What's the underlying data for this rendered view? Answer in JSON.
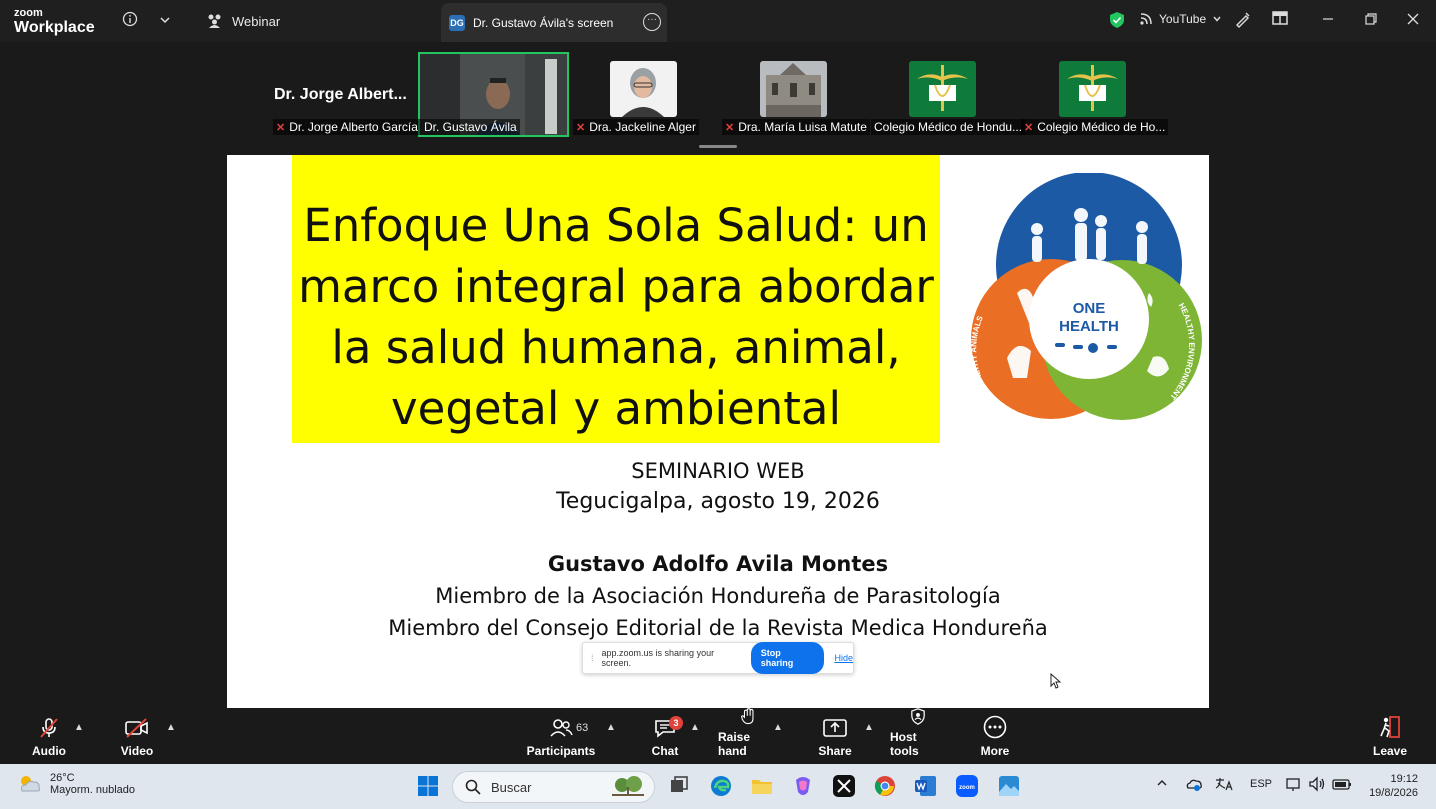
{
  "titlebar": {
    "logo_small": "zoom",
    "logo_big": "Workplace",
    "webinar_label": "Webinar",
    "screen_tab_badge": "DG",
    "screen_tab_label": "Dr. Gustavo Ávila's screen",
    "youtube_label": "YouTube"
  },
  "gallery": {
    "speaker_name": "Dr. Jorge Albert...",
    "participants": [
      {
        "label": "Dr. Jorge Alberto García"
      },
      {
        "label": "Dr. Gustavo Ávila"
      },
      {
        "label": "Dra. Jackeline Alger"
      },
      {
        "label": "Dra. María Luisa Matute"
      },
      {
        "label": "Colegio Médico de Hondu..."
      },
      {
        "label": "Colegio Médico de Ho..."
      }
    ]
  },
  "slide": {
    "title_lines": [
      "Enfoque Una Sola Salud: un",
      "marco integral para abordar",
      "la salud humana, animal,",
      "vegetal y ambiental"
    ],
    "logo_center_1": "ONE",
    "logo_center_2": "HEALTH",
    "logo_top": "HEALTHY PEOPLE",
    "logo_left": "HEALTHY ANIMALS",
    "logo_right": "HEALTHY ENVIRONMENT",
    "subtitle": "SEMINARIO WEB",
    "place_date": "Tegucigalpa, agosto 19, 2026",
    "author": "Gustavo Adolfo Avila Montes",
    "affiliation_1": "Miembro de la Asociación Hondureña de Parasitología",
    "affiliation_2": "Miembro del Consejo Editorial de la Revista Medica Hondureña"
  },
  "sharebar": {
    "message": "app.zoom.us is sharing your screen.",
    "stop_label": "Stop sharing",
    "hide_label": "Hide"
  },
  "toolbar": {
    "audio": "Audio",
    "video": "Video",
    "participants": "Participants",
    "participants_count": "63",
    "chat": "Chat",
    "chat_badge": "3",
    "raise_hand": "Raise hand",
    "share": "Share",
    "host_tools": "Host tools",
    "more": "More",
    "leave": "Leave"
  },
  "taskbar": {
    "temperature": "26°C",
    "weather_desc": "Mayorm. nublado",
    "search_placeholder": "Buscar",
    "language": "ESP",
    "time": "19:12",
    "date": "19/8/2026"
  },
  "colors": {
    "active_speaker_border": "#22c55e",
    "slide_highlight": "#ffff00",
    "stop_sharing": "#0e72ed",
    "badge": "#e0433a"
  }
}
